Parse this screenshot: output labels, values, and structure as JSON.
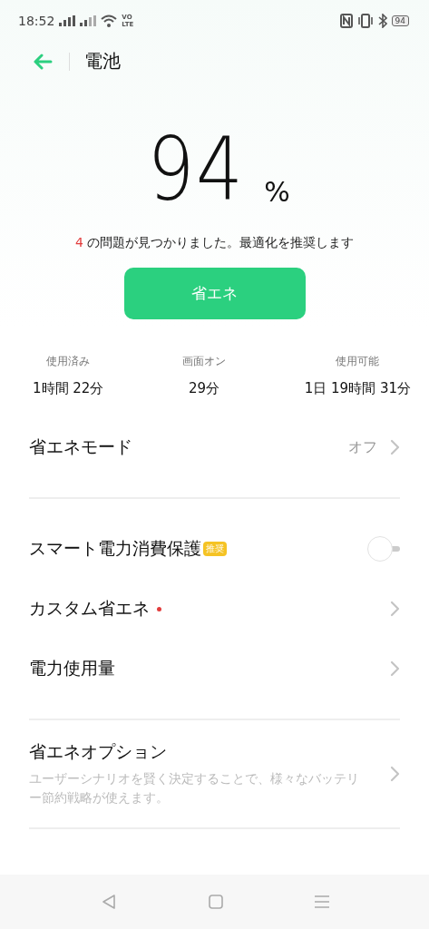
{
  "status_bar": {
    "time": "18:52",
    "network_top": "VO",
    "network_bottom": "LTE",
    "battery": "94"
  },
  "header": {
    "title": "電池"
  },
  "battery": {
    "percent": "94",
    "unit": "%",
    "issue_count": "4",
    "issue_text": "の問題が見つかりました。最適化を推奨します",
    "button": "省エネ"
  },
  "stats": [
    {
      "label": "使用済み",
      "value": "1時間 22分"
    },
    {
      "label": "画面オン",
      "value": "29分"
    },
    {
      "label": "使用可能",
      "value": "1日 19時間 31分"
    }
  ],
  "sections": [
    {
      "rows": [
        {
          "kind": "value",
          "title": "省エネモード",
          "value": "オフ"
        }
      ]
    },
    {
      "rows": [
        {
          "kind": "toggle",
          "title": "スマート電力消費保護",
          "badge": "推奨",
          "on": false
        },
        {
          "kind": "link",
          "title": "カスタム省エネ",
          "dot": true
        },
        {
          "kind": "link",
          "title": "電力使用量",
          "dot": false
        }
      ]
    },
    {
      "rows": [
        {
          "kind": "link",
          "title": "省エネオプション",
          "dot": false,
          "description": "ユーザーシナリオを賢く決定することで、様々なバッテリー節約戦略が使えます。"
        }
      ]
    }
  ]
}
